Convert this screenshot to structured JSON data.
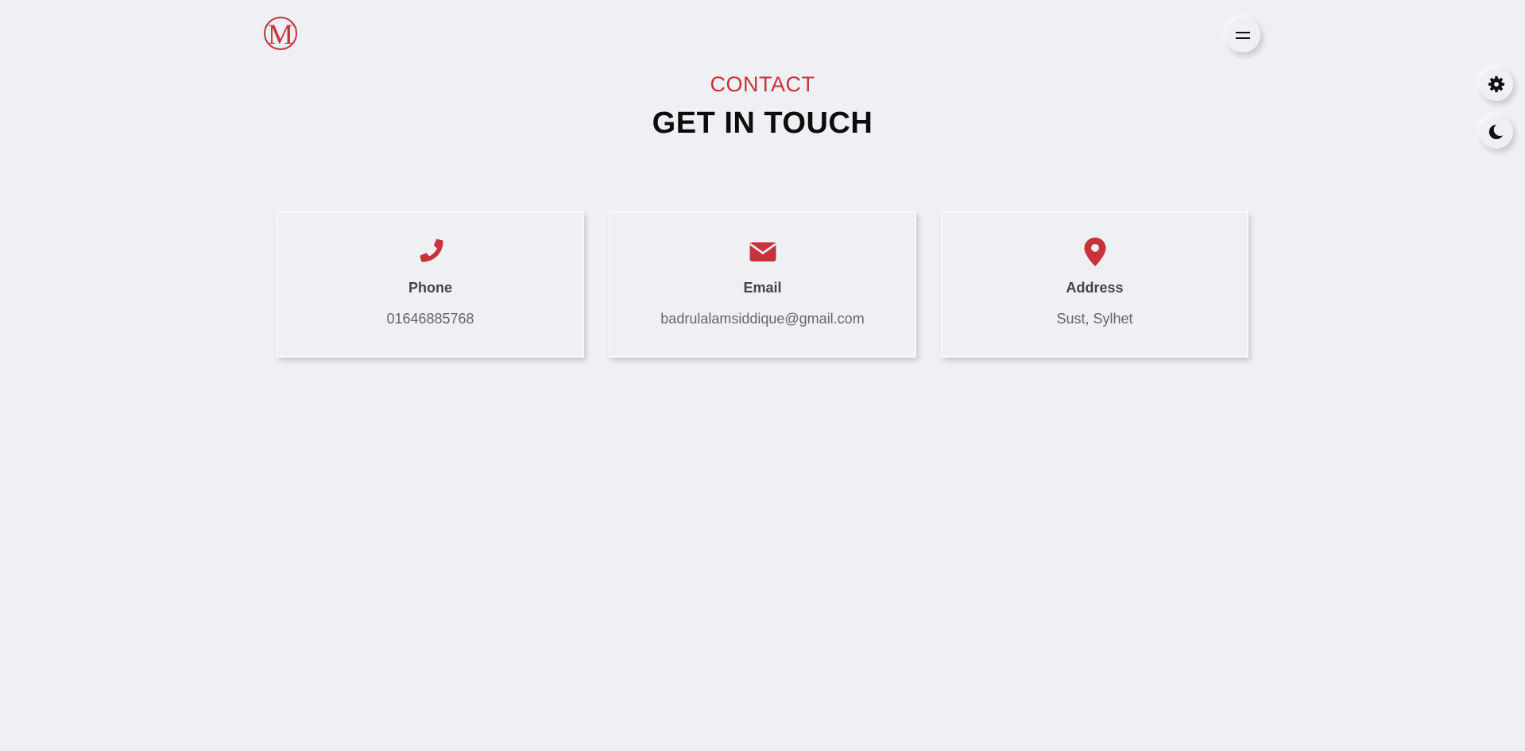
{
  "header": {
    "logo_letter": "M"
  },
  "section": {
    "label": "CONTACT",
    "title": "GET IN TOUCH"
  },
  "cards": [
    {
      "icon": "phone-icon",
      "title": "Phone",
      "value": "01646885768"
    },
    {
      "icon": "envelope-icon",
      "title": "Email",
      "value": "badrulalamsiddique@gmail.com"
    },
    {
      "icon": "map-pin-icon",
      "title": "Address",
      "value": "Sust, Sylhet"
    }
  ],
  "side_buttons": {
    "settings_icon": "gear-icon",
    "theme_icon": "moon-icon"
  },
  "colors": {
    "accent": "#c8323a",
    "background": "#eef0f4",
    "title": "#0c0c0c",
    "card_title": "#444444",
    "card_text": "#666666"
  }
}
